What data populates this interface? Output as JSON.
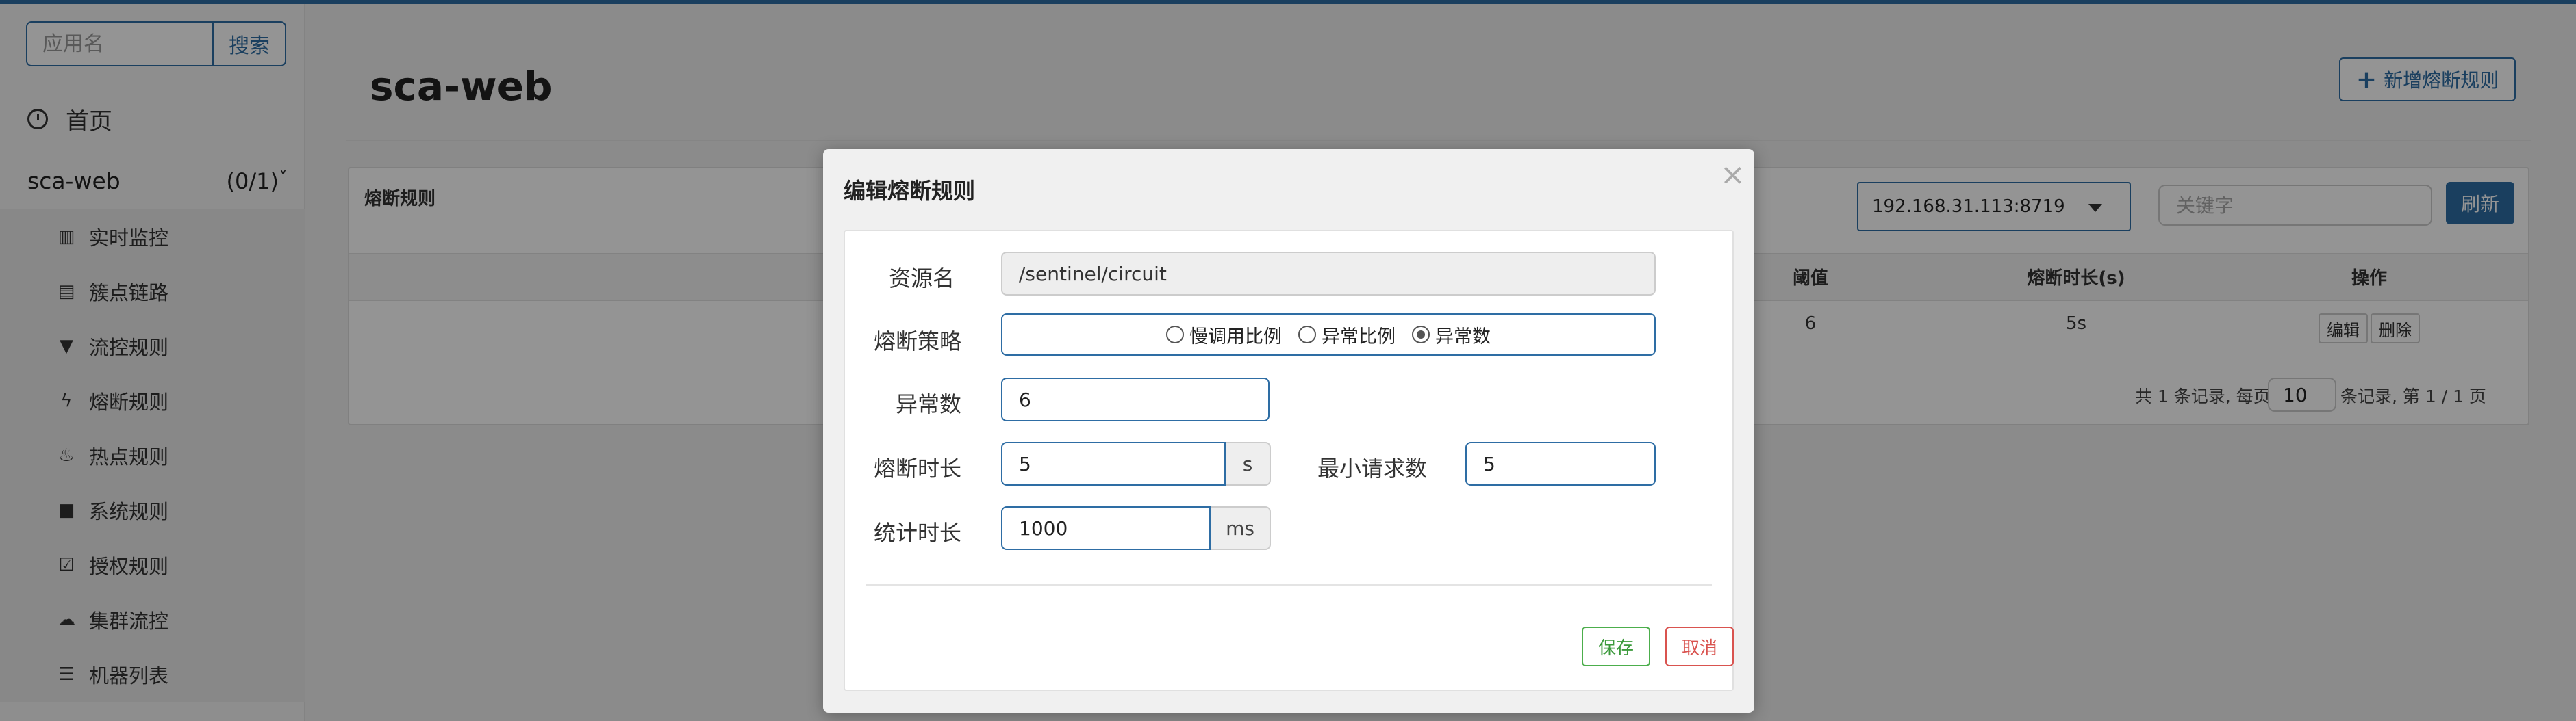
{
  "sidebar": {
    "search_placeholder": "应用名",
    "search_button": "搜索",
    "home_label": "首页",
    "app_name": "sca-web",
    "app_count": "(0/1)",
    "items": [
      {
        "label": "实时监控",
        "icon": "bar-chart-icon"
      },
      {
        "label": "簇点链路",
        "icon": "table-icon"
      },
      {
        "label": "流控规则",
        "icon": "filter-icon"
      },
      {
        "label": "熔断规则",
        "icon": "flash-icon"
      },
      {
        "label": "热点规则",
        "icon": "fire-icon"
      },
      {
        "label": "系统规则",
        "icon": "lock-icon"
      },
      {
        "label": "授权规则",
        "icon": "check-square-icon"
      },
      {
        "label": "集群流控",
        "icon": "cloud-icon"
      },
      {
        "label": "机器列表",
        "icon": "list-icon"
      }
    ]
  },
  "main": {
    "title": "sca-web",
    "add_button": "新增熔断规则",
    "panel_title": "熔断规则",
    "ip_select": "192.168.31.113:8719",
    "keyword_placeholder": "关键字",
    "refresh_button": "刷新",
    "columns": {
      "threshold": "阈值",
      "duration": "熔断时长(s)",
      "actions": "操作"
    },
    "row": {
      "threshold": "6",
      "duration": "5s"
    },
    "edit_button": "编辑",
    "delete_button": "删除",
    "pager_prefix": "共 1 条记录, 每页",
    "pager_size": "10",
    "pager_suffix": "条记录, 第 1 / 1 页"
  },
  "modal": {
    "title": "编辑熔断规则",
    "close": "×",
    "resource_label": "资源名",
    "resource_value": "/sentinel/circuit",
    "strategy_label": "熔断策略",
    "strategy_options": [
      "慢调用比例",
      "异常比例",
      "异常数"
    ],
    "strategy_selected": "异常数",
    "count_label": "异常数",
    "count_value": "6",
    "duration_label": "熔断时长",
    "duration_value": "5",
    "duration_unit": "s",
    "min_request_label": "最小请求数",
    "min_request_value": "5",
    "stat_label": "统计时长",
    "stat_value": "1000",
    "stat_unit": "ms",
    "save_button": "保存",
    "cancel_button": "取消"
  }
}
